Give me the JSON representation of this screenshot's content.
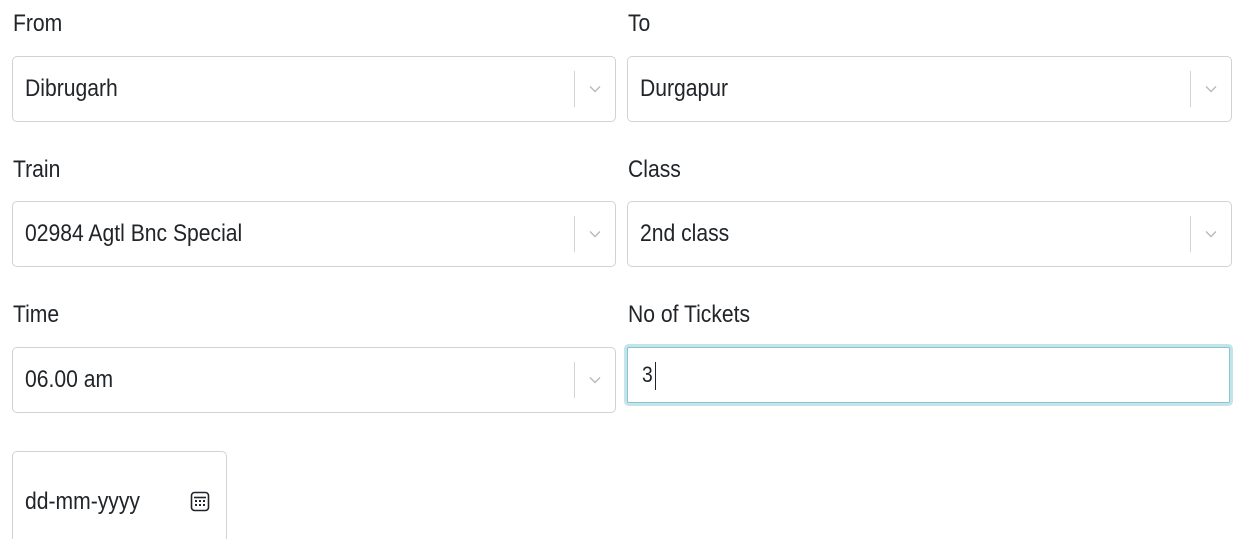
{
  "form": {
    "from": {
      "label": "From",
      "value": "Dibrugarh"
    },
    "to": {
      "label": "To",
      "value": "Durgapur"
    },
    "train": {
      "label": "Train",
      "value": "02984 Agtl Bnc Special"
    },
    "class": {
      "label": "Class",
      "value": "2nd class"
    },
    "time": {
      "label": "Time",
      "value": "06.00 am"
    },
    "tickets": {
      "label": "No of Tickets",
      "value": "3"
    },
    "date": {
      "placeholder": "dd-mm-yyyy",
      "icon": "calendar-icon"
    }
  },
  "colors": {
    "border": "#cfd3d8",
    "focus_border": "#86c6d3",
    "text": "#212529",
    "chevron": "#b5b9bd"
  }
}
